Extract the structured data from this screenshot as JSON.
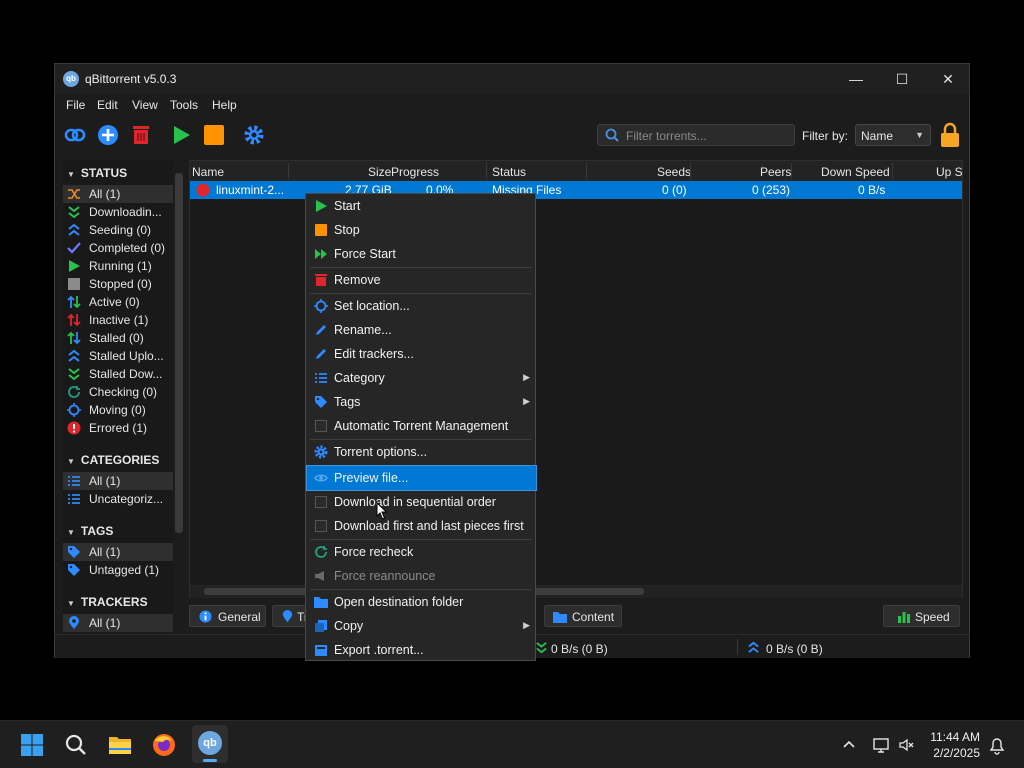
{
  "window": {
    "title": "qBittorrent v5.0.3",
    "app_icon_text": "qb"
  },
  "menubar": [
    "File",
    "Edit",
    "View",
    "Tools",
    "Help"
  ],
  "toolbar": {
    "filter_placeholder": "Filter torrents...",
    "filter_by_label": "Filter by:",
    "filter_by_value": "Name"
  },
  "sidebar": {
    "status_header": "STATUS",
    "status_items": [
      {
        "label": "All (1)",
        "icon": "shuffle-icon"
      },
      {
        "label": "Downloadin...",
        "icon": "download-icon"
      },
      {
        "label": "Seeding (0)",
        "icon": "upload-icon"
      },
      {
        "label": "Completed (0)",
        "icon": "check-icon"
      },
      {
        "label": "Running (1)",
        "icon": "play-icon"
      },
      {
        "label": "Stopped (0)",
        "icon": "stop-icon"
      },
      {
        "label": "Active (0)",
        "icon": "active-arrows-icon"
      },
      {
        "label": "Inactive (1)",
        "icon": "inactive-arrows-icon"
      },
      {
        "label": "Stalled (0)",
        "icon": "stalled-icon"
      },
      {
        "label": "Stalled Uplo...",
        "icon": "stalled-upload-icon"
      },
      {
        "label": "Stalled Dow...",
        "icon": "stalled-download-icon"
      },
      {
        "label": "Checking (0)",
        "icon": "refresh-icon"
      },
      {
        "label": "Moving (0)",
        "icon": "moving-icon"
      },
      {
        "label": "Errored (1)",
        "icon": "error-icon"
      }
    ],
    "categories_header": "CATEGORIES",
    "category_items": [
      {
        "label": "All (1)"
      },
      {
        "label": "Uncategoriz..."
      }
    ],
    "tags_header": "TAGS",
    "tag_items": [
      {
        "label": "All (1)"
      },
      {
        "label": "Untagged (1)"
      }
    ],
    "trackers_header": "TRACKERS",
    "tracker_items": [
      {
        "label": "All (1)"
      }
    ]
  },
  "list": {
    "columns": [
      "Name",
      "Size",
      "Progress",
      "Status",
      "Seeds",
      "Peers",
      "Down Speed",
      "Up S"
    ],
    "rows": [
      {
        "name": "linuxmint-2...",
        "size": "2.77 GiB",
        "progress": "0.0%",
        "status": "Missing Files",
        "seeds": "0 (0)",
        "peers": "0 (253)",
        "down_speed": "0 B/s"
      }
    ]
  },
  "bottom_tabs": {
    "general": "General",
    "trackers_partial": "Tr",
    "content": "Content",
    "speed": "Speed"
  },
  "statusbar": {
    "down": "0 B/s (0 B)",
    "up": "0 B/s (0 B)"
  },
  "context_menu": [
    {
      "label": "Start",
      "icon": "play-icon"
    },
    {
      "label": "Stop",
      "icon": "stop-icon"
    },
    {
      "label": "Force Start",
      "icon": "fast-forward-icon"
    },
    {
      "label": "Remove",
      "icon": "trash-icon"
    },
    {
      "label": "Set location...",
      "icon": "target-icon"
    },
    {
      "label": "Rename...",
      "icon": "pencil-icon"
    },
    {
      "label": "Edit trackers...",
      "icon": "pencil-icon"
    },
    {
      "label": "Category",
      "icon": "list-icon",
      "submenu": true
    },
    {
      "label": "Tags",
      "icon": "tag-icon",
      "submenu": true
    },
    {
      "label": "Automatic Torrent Management",
      "checkbox": true
    },
    {
      "label": "Torrent options...",
      "icon": "gear-icon"
    },
    {
      "label": "Preview file...",
      "icon": "eye-icon",
      "highlighted": true
    },
    {
      "label": "Download in sequential order",
      "checkbox": true
    },
    {
      "label": "Download first and last pieces first",
      "checkbox": true
    },
    {
      "label": "Force recheck",
      "icon": "refresh-icon"
    },
    {
      "label": "Force reannounce",
      "icon": "megaphone-icon",
      "disabled": true
    },
    {
      "label": "Open destination folder",
      "icon": "folder-icon"
    },
    {
      "label": "Copy",
      "icon": "copy-icon",
      "submenu": true
    },
    {
      "label": "Export .torrent...",
      "icon": "export-icon"
    }
  ],
  "taskbar": {
    "time": "11:44 AM",
    "date": "2/2/2025"
  }
}
